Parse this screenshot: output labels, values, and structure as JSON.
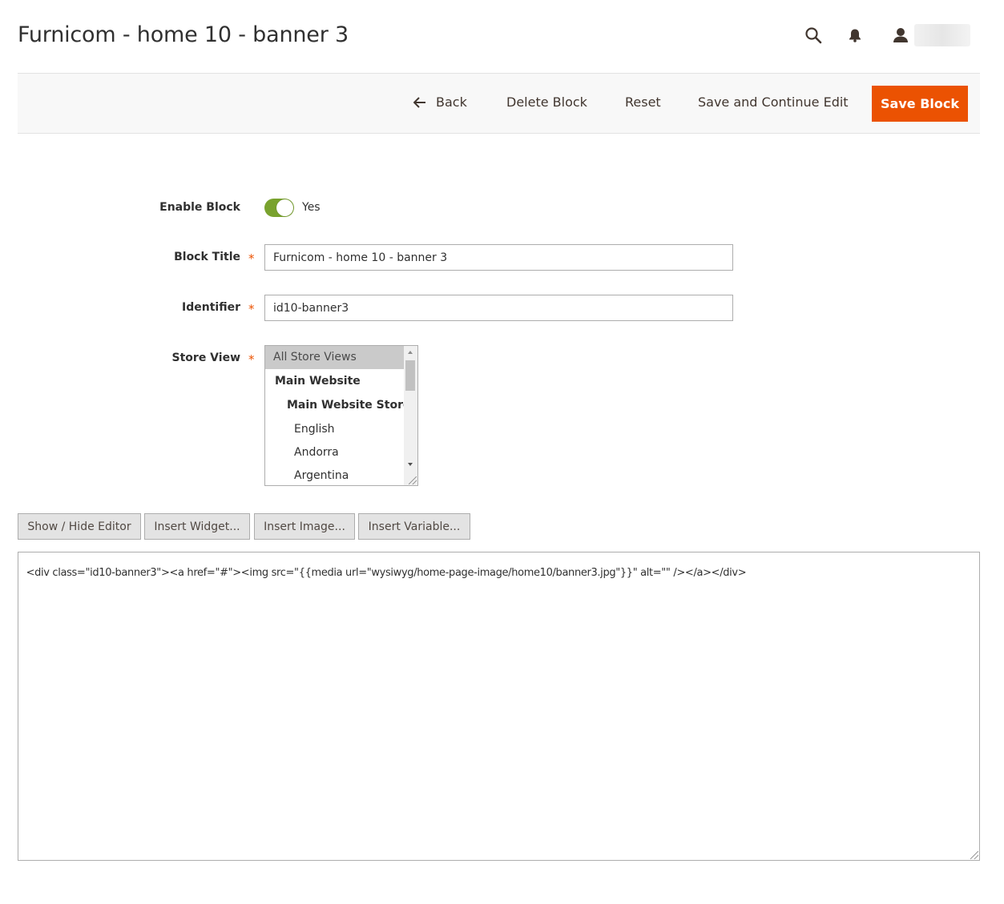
{
  "page": {
    "title": "Furnicom - home 10 - banner 3"
  },
  "header": {
    "search_icon": "search-icon",
    "notifications_icon": "bell-icon",
    "user_icon": "user-icon"
  },
  "toolbar": {
    "back_label": "Back",
    "delete_label": "Delete Block",
    "reset_label": "Reset",
    "save_continue_label": "Save and Continue Edit",
    "save_label": "Save Block",
    "save_color": "#eb5202"
  },
  "form": {
    "enable_block": {
      "label": "Enable Block",
      "value_label": "Yes",
      "enabled": true,
      "toggle_color": "#79a22e"
    },
    "block_title": {
      "label": "Block Title",
      "required_mark": "*",
      "value": "Furnicom - home 10 - banner 3"
    },
    "identifier": {
      "label": "Identifier",
      "required_mark": "*",
      "value": "id10-banner3"
    },
    "store_view": {
      "label": "Store View",
      "required_mark": "*",
      "options": [
        {
          "label": "All Store Views",
          "selected": true
        },
        {
          "label": "Main Website"
        },
        {
          "label": "Main Website Store"
        },
        {
          "label": "English"
        },
        {
          "label": "Andorra"
        },
        {
          "label": "Argentina"
        }
      ]
    }
  },
  "editor": {
    "buttons": {
      "show_hide": "Show / Hide Editor",
      "insert_widget": "Insert Widget...",
      "insert_image": "Insert Image...",
      "insert_variable": "Insert Variable..."
    },
    "content": "<div class=\"id10-banner3\"><a href=\"#\"><img src=\"{{media url=\"wysiwyg/home-page-image/home10/banner3.jpg\"}}\" alt=\"\" /></a></div>"
  }
}
